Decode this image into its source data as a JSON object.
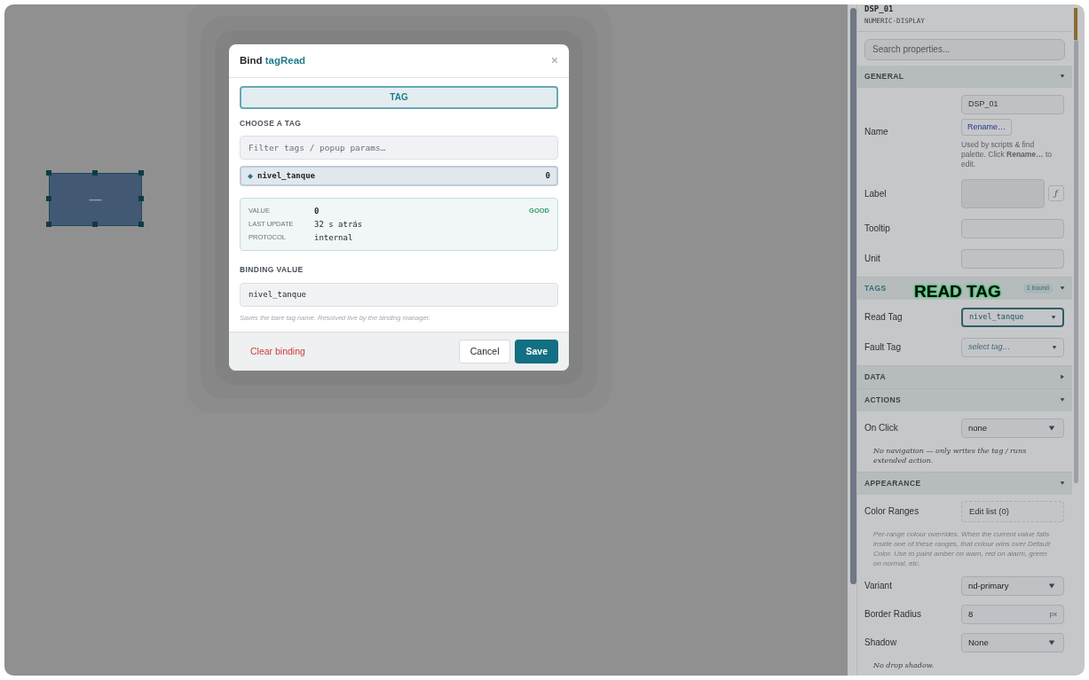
{
  "canvas": {
    "widget": {
      "display_value": "—",
      "selected": true
    }
  },
  "dialog": {
    "title_prefix": "Bind",
    "title_target": "tagRead",
    "close": "×",
    "mode_tabs": [
      {
        "label": "TAG",
        "selected": true
      }
    ],
    "choose_label": "CHOOSE A TAG",
    "filter": {
      "placeholder": "Filter tags / popup params…"
    },
    "tags": [
      {
        "name": "nivel_tanque",
        "value": "0",
        "selected": true
      }
    ],
    "details": {
      "quality": "GOOD",
      "rows": [
        {
          "label": "VALUE",
          "value": "0"
        },
        {
          "label": "LAST UPDATE",
          "value": "32 s atrás"
        },
        {
          "label": "PROTOCOL",
          "value": "internal"
        }
      ]
    },
    "binding_label": "BINDING VALUE",
    "binding_value": "nivel_tanque",
    "hint": "Saves the bare tag name. Resolved live by the binding manager.",
    "buttons": {
      "clear": "Clear binding",
      "cancel": "Cancel",
      "save": "Save"
    }
  },
  "panel": {
    "name": "DSP_01",
    "type": "NUMERIC-DISPLAY",
    "search": {
      "placeholder": "Search properties..."
    },
    "sections": [
      {
        "title": "GENERAL",
        "expanded": true,
        "rows": [
          {
            "kind": "rename",
            "label": "Name",
            "value": "DSP_01",
            "button": "Rename…",
            "note": "Used by scripts & find palette. Click **Rename…** to edit."
          },
          {
            "kind": "textarea",
            "label": "Label",
            "button": "ƒ"
          },
          {
            "kind": "text",
            "label": "Tooltip"
          },
          {
            "kind": "text",
            "label": "Unit"
          }
        ]
      },
      {
        "title": "TAGS",
        "expanded": true,
        "badge": "1 bound",
        "rows": [
          {
            "kind": "tag_select",
            "label": "Read Tag",
            "value": "nivel_tanque",
            "focused": true
          },
          {
            "kind": "tag_select",
            "label": "Fault Tag",
            "placeholder": "select tag…",
            "focused": false
          }
        ]
      },
      {
        "title": "DATA",
        "expanded": false
      },
      {
        "title": "ACTIONS",
        "expanded": true,
        "rows": [
          {
            "kind": "dropdown",
            "label": "On Click",
            "value": "none"
          },
          {
            "kind": "serif_note",
            "text": "No navigation — only writes the tag / runs extended action."
          }
        ]
      },
      {
        "title": "APPEARANCE",
        "expanded": true,
        "rows": [
          {
            "kind": "list_button",
            "label": "Color Ranges",
            "button": "Edit list (0)"
          },
          {
            "kind": "note",
            "text": "Per-range colour overrides. When the current value falls inside one of these ranges, that colour wins over Default Color. Use to paint amber on warn, red on alarm, green on normal, etc."
          },
          {
            "kind": "dropdown",
            "label": "Variant",
            "value": "nd-primary"
          },
          {
            "kind": "number",
            "label": "Border Radius",
            "value": "8",
            "unit": "px"
          },
          {
            "kind": "dropdown",
            "label": "Shadow",
            "value": "None"
          },
          {
            "kind": "serif_note",
            "text": "No drop shadow."
          }
        ]
      }
    ]
  },
  "annotation": "READ TAG"
}
